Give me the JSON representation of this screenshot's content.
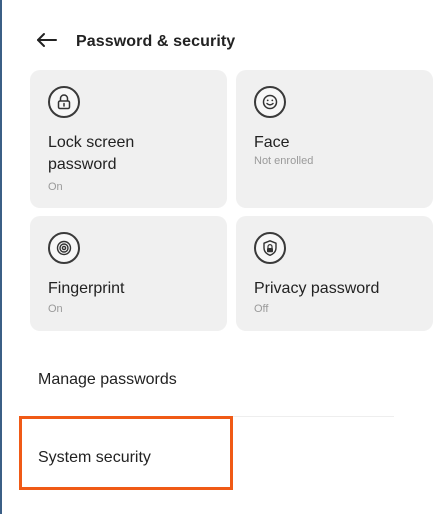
{
  "header": {
    "back_icon": "arrow-left-icon",
    "title": "Password & security"
  },
  "tiles": [
    {
      "icon": "lock-icon",
      "label": "Lock screen password",
      "status": "On"
    },
    {
      "icon": "face-icon",
      "label": "Face",
      "status": "Not enrolled"
    },
    {
      "icon": "fingerprint-icon",
      "label": "Fingerprint",
      "status": "On"
    },
    {
      "icon": "shield-lock-icon",
      "label": "Privacy password",
      "status": "Off"
    }
  ],
  "list": {
    "manage_passwords": "Manage passwords",
    "system_security": "System security"
  },
  "colors": {
    "tile_background": "#f0f0f0",
    "highlight": "#f05a16",
    "status_text": "#9a9a9a"
  }
}
